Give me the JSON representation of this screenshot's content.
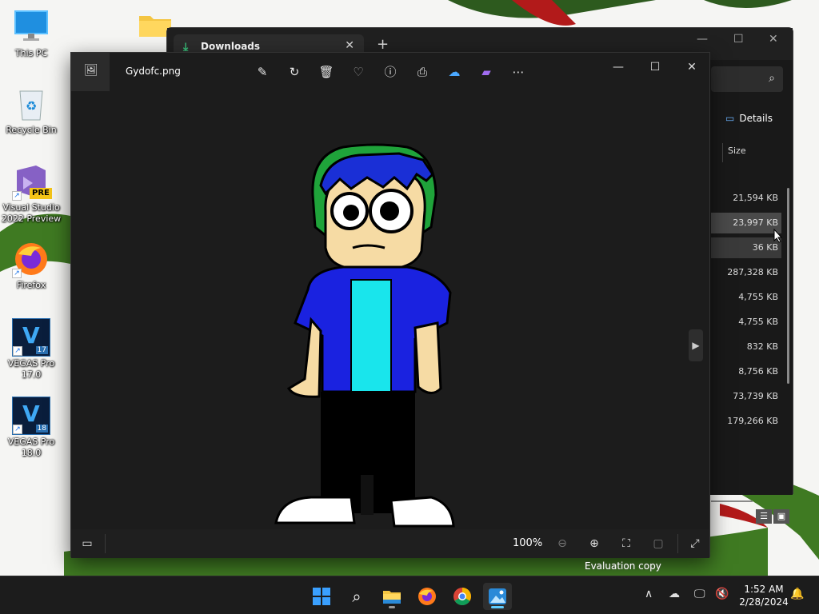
{
  "desktop": {
    "icons": [
      {
        "label": "This PC"
      },
      {
        "label": "Recycle Bin"
      },
      {
        "label": "Visual Studio 2022 Preview",
        "badge": "PRE"
      },
      {
        "label": "Firefox"
      },
      {
        "label": "VEGAS Pro 17.0",
        "letter": "V",
        "version": "17"
      },
      {
        "label": "VEGAS Pro 18.0",
        "letter": "V",
        "version": "18"
      }
    ],
    "watermark": "Evaluation copy"
  },
  "explorer": {
    "tab_title": "Downloads",
    "details_label": "Details",
    "size_header": "Size",
    "sizes": [
      "21,594 KB",
      "23,997 KB",
      "36 KB",
      "287,328 KB",
      "4,755 KB",
      "4,755 KB",
      "832 KB",
      "8,756 KB",
      "73,739 KB",
      "179,266 KB"
    ]
  },
  "viewer": {
    "filename": "Gydofc.png",
    "zoom": "100%",
    "toolbar_icons": [
      "edit-image-icon",
      "rotate-icon",
      "delete-icon",
      "favorite-icon",
      "info-icon",
      "print-icon",
      "onedrive-icon",
      "video-editor-icon",
      "more-icon"
    ]
  },
  "taskbar": {
    "time": "1:52 AM",
    "date": "2/28/2024"
  },
  "colors": {
    "accent": "#60cdff",
    "character_hair": "#1a2fd6",
    "character_hood": "#1fa33a",
    "character_shirt": "#1a22e0",
    "character_undershirt": "#19e5ec",
    "character_skin": "#f6dba4"
  }
}
